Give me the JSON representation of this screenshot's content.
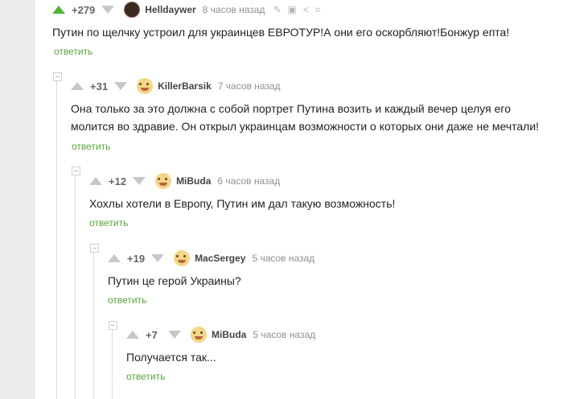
{
  "reply_label": "ответить",
  "colors": {
    "accent": "#53b437",
    "reply": "#5aa53a",
    "inactive_arrow": "#c7c7c7"
  },
  "icons": [
    "pencil-icon",
    "save-icon",
    "share-icon",
    "collapse-icon"
  ],
  "comments": [
    {
      "score": "+279",
      "author": "Helldaywer",
      "time": "8 часов назад",
      "text": "Путин по щелчку устроил для украинцев ЕВРОТУР!А они его оскорбляют!Бонжур епта!"
    },
    {
      "score": "+31",
      "author": "KillerBarsik",
      "time": "7 часов назад",
      "text": "Она только за это должна с собой портрет Путина возить и каждый вечер целуя его молится во здравие. Он открыл украинцам возможности о которых они даже не мечтали!"
    },
    {
      "score": "+12",
      "author": "MiBuda",
      "time": "6 часов назад",
      "text": "Хохлы хотели в Европу, Путин им дал такую возможность!"
    },
    {
      "score": "+19",
      "author": "MacSergey",
      "time": "5 часов назад",
      "text": "Путин це герой Украины?"
    },
    {
      "score": "+7",
      "author": "MiBuda",
      "time": "5 часов назад",
      "text": "Получается так..."
    }
  ]
}
